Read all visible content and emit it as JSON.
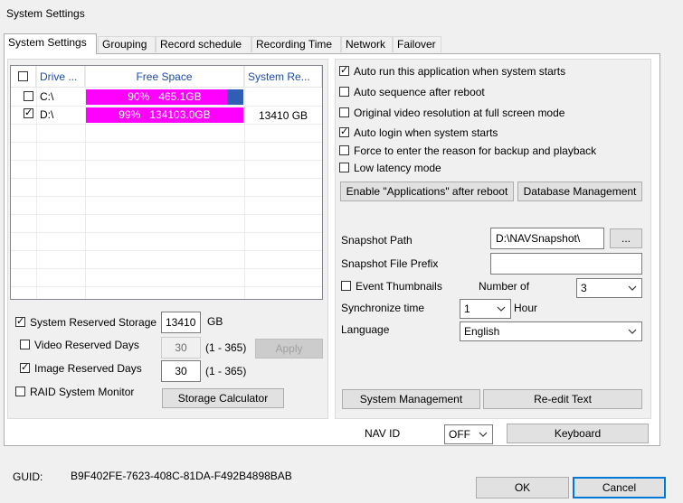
{
  "window": {
    "title": "System Settings"
  },
  "tabs": [
    {
      "label": "System Settings",
      "active": true
    },
    {
      "label": "Grouping"
    },
    {
      "label": "Record schedule"
    },
    {
      "label": "Recording Time"
    },
    {
      "label": "Network"
    },
    {
      "label": "Failover"
    }
  ],
  "drives": {
    "headers": [
      "Drive ...",
      "Free Space",
      "System Re..."
    ],
    "rows": [
      {
        "checked": false,
        "drive": "C:\\",
        "free_pct_text": "90%",
        "free_size": "465.1GB",
        "fill_fraction": 0.9,
        "reserved": ""
      },
      {
        "checked": true,
        "drive": "D:\\",
        "free_pct_text": "99%",
        "free_size": "134103.0GB",
        "fill_fraction": 1.0,
        "reserved": "13410 GB"
      }
    ]
  },
  "storage": {
    "system_reserved_label": "System Reserved Storage",
    "system_reserved_value": "13410",
    "system_reserved_unit": "GB",
    "video_reserved_label": "Video Reserved Days",
    "video_reserved_value": "30",
    "video_range": "(1 - 365)",
    "apply_label": "Apply",
    "image_reserved_label": "Image Reserved Days",
    "image_reserved_value": "30",
    "image_range": "(1 - 365)",
    "raid_label": "RAID System Monitor",
    "calculator_label": "Storage Calculator"
  },
  "options": {
    "auto_run": "Auto run this application when system starts",
    "auto_sequence": "Auto sequence after reboot",
    "original_res": "Original video resolution at full screen mode",
    "auto_login": "Auto login when system starts",
    "force_reason": "Force to enter the reason for backup and playback",
    "low_latency": "Low latency mode",
    "enable_apps_button": "Enable \"Applications\" after reboot",
    "db_mgmt_button": "Database Management"
  },
  "snapshot": {
    "path_label": "Snapshot Path",
    "path_value": "D:\\NAVSnapshot\\",
    "browse_label": "...",
    "prefix_label": "Snapshot File Prefix",
    "prefix_value": "",
    "event_thumbs_label": "Event Thumbnails",
    "number_of_label": "Number of",
    "number_of_value": "3",
    "sync_label": "Synchronize time",
    "sync_value": "1",
    "hour_label": "Hour",
    "language_label": "Language",
    "language_value": "English"
  },
  "bottom_buttons": {
    "system_mgmt": "System Management",
    "reedit_text": "Re-edit Text"
  },
  "nav": {
    "label": "NAV ID",
    "value": "OFF",
    "keyboard": "Keyboard"
  },
  "footer": {
    "guid_label": "GUID:",
    "guid_value": "B9F402FE-7623-408C-81DA-F492B4898BAB",
    "ok": "OK",
    "cancel": "Cancel"
  },
  "colors": {
    "bar_fill": "#ff00ff",
    "bar_remainder": "#2e5fb4",
    "header_text": "#1a4ba6",
    "focus_border": "#0078d7"
  }
}
